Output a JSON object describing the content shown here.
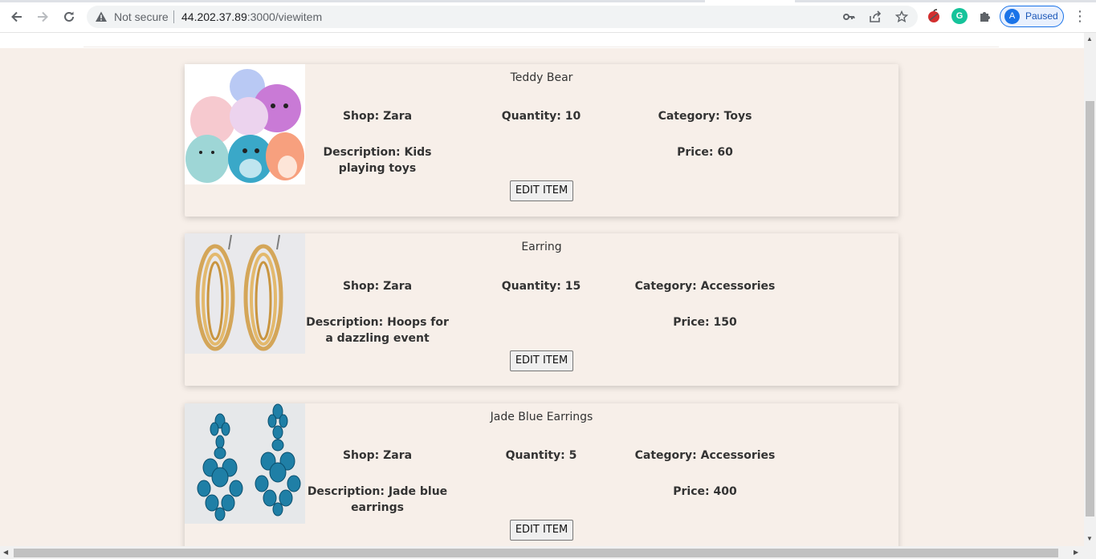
{
  "browser": {
    "security_text": "Not secure",
    "url_host": "44.202.37.89",
    "url_rest": ":3000/viewitem",
    "profile_initial": "A",
    "profile_status": "Paused"
  },
  "items": [
    {
      "name": "Teddy Bear",
      "shop": "Shop: Zara",
      "quantity": "Quantity: 10",
      "category": "Category: Toys",
      "description": "Description: Kids playing toys",
      "price": "Price: 60",
      "button": "EDIT ITEM",
      "image": "plush-toys-image"
    },
    {
      "name": "Earring",
      "shop": "Shop: Zara",
      "quantity": "Quantity: 15",
      "category": "Category: Accessories",
      "description": "Description: Hoops for a dazzling event",
      "price": "Price: 150",
      "button": "EDIT ITEM",
      "image": "gold-hoop-earrings-image"
    },
    {
      "name": "Jade Blue Earrings",
      "shop": "Shop: Zara",
      "quantity": "Quantity: 5",
      "category": "Category: Accessories",
      "description": "Description: Jade blue earrings",
      "price": "Price: 400",
      "button": "EDIT ITEM",
      "image": "blue-jewel-earrings-image"
    }
  ],
  "colors": {
    "page_background": "#f7efe9",
    "accent": "#1a73e8"
  }
}
